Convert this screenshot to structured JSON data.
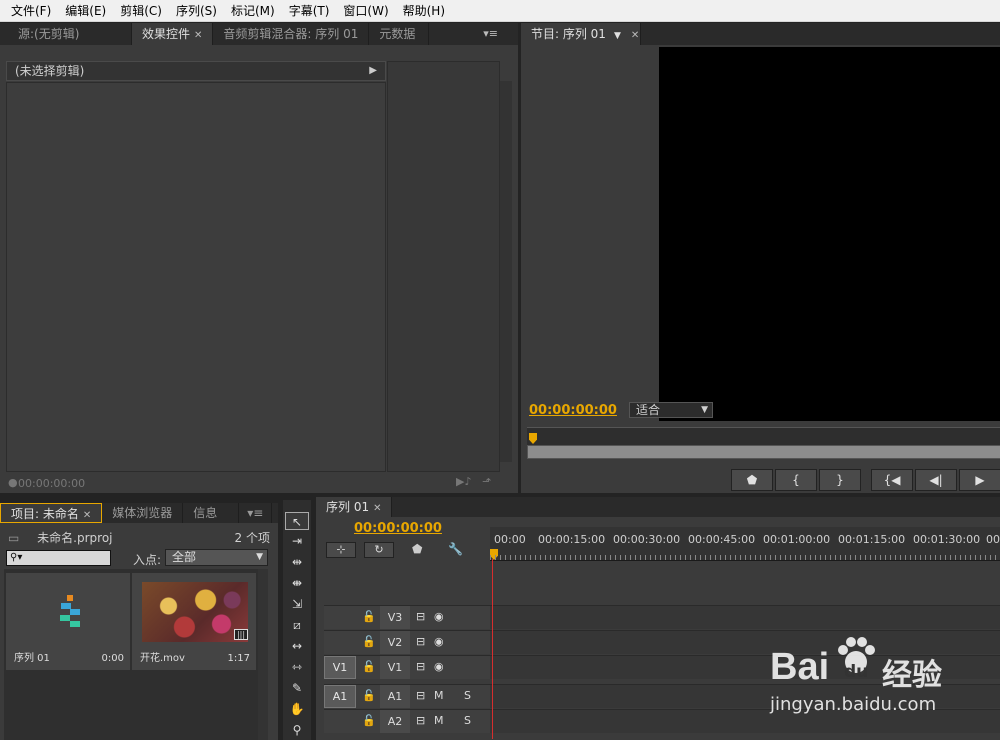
{
  "menu": [
    "文件(F)",
    "编辑(E)",
    "剪辑(C)",
    "序列(S)",
    "标记(M)",
    "字幕(T)",
    "窗口(W)",
    "帮助(H)"
  ],
  "source_panel": {
    "tabs": [
      "源:(无剪辑)",
      "效果控件",
      "音频剪辑混合器: 序列 01",
      "元数据"
    ],
    "active_tab": 1,
    "no_clip": "(未选择剪辑)",
    "timecode": "00:00:00:00"
  },
  "program": {
    "tab": "节目: 序列 01",
    "timecode": "00:00:00:00",
    "fit": "适合"
  },
  "project": {
    "tabs": [
      "项目: 未命名",
      "媒体浏览器",
      "信息"
    ],
    "file": "未命名.prproj",
    "count": "2 个项",
    "inpoint_label": "入点:",
    "inpoint_value": "全部",
    "items": [
      {
        "name": "序列 01",
        "duration": "0:00"
      },
      {
        "name": "开花.mov",
        "duration": "1:17"
      }
    ]
  },
  "timeline": {
    "tab": "序列 01",
    "timecode": "00:00:00:00",
    "ruler": [
      "00:00",
      "00:00:15:00",
      "00:00:30:00",
      "00:00:45:00",
      "00:01:00:00",
      "00:01:15:00",
      "00:01:30:00",
      "00:0"
    ],
    "tracks": [
      {
        "source": "",
        "name": "V3",
        "c1": "",
        "c2": ""
      },
      {
        "source": "",
        "name": "V2",
        "c1": "",
        "c2": ""
      },
      {
        "source": "V1",
        "name": "V1",
        "c1": "",
        "c2": ""
      },
      {
        "source": "A1",
        "name": "A1",
        "c1": "M",
        "c2": "S"
      },
      {
        "source": "",
        "name": "A2",
        "c1": "M",
        "c2": "S"
      }
    ]
  },
  "watermark": {
    "brand": "Bai",
    "brand2": "du",
    "cn": "经验",
    "url": "jingyan.baidu.com"
  },
  "colors": {
    "accent": "#e8a700",
    "playhead": "#d62e2e"
  }
}
